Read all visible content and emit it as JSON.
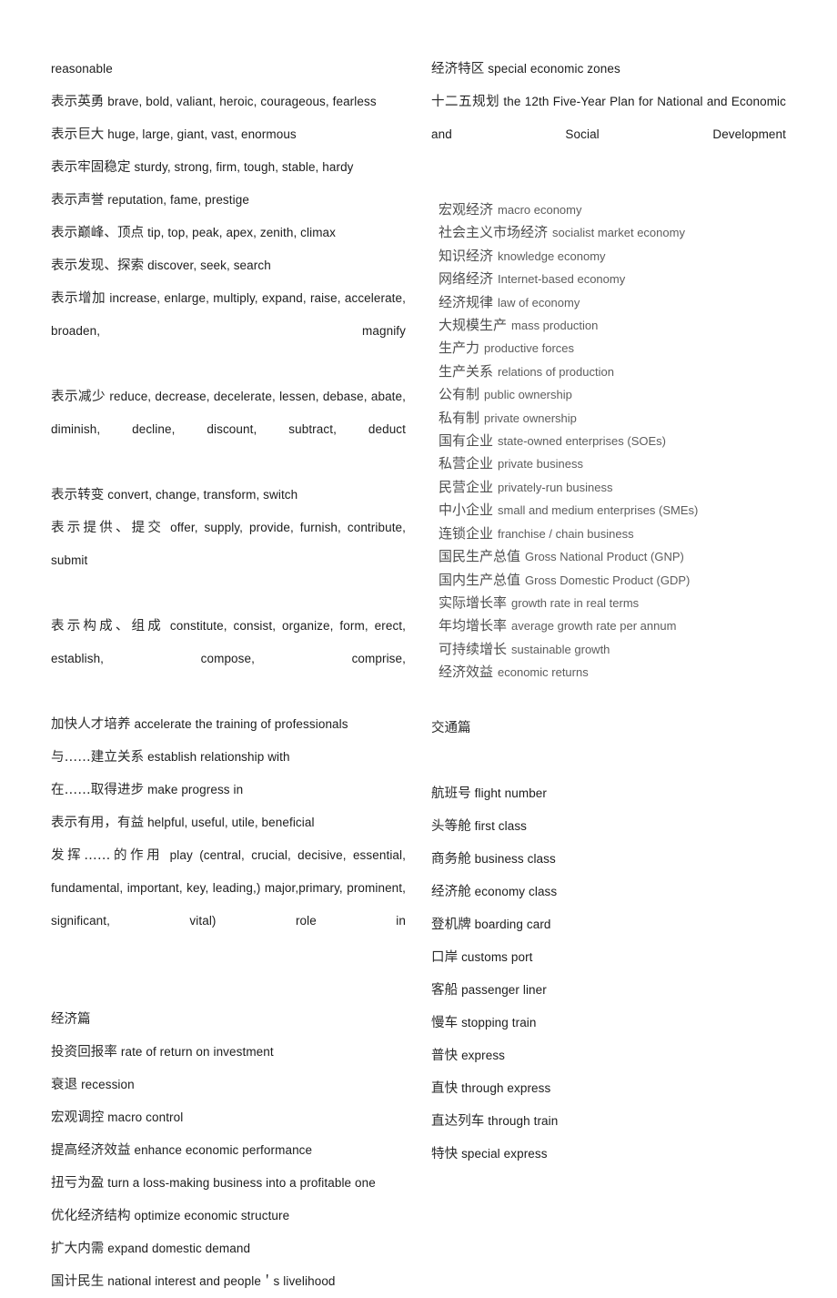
{
  "document": {
    "columns": {
      "left": {
        "blocks": [
          {
            "type": "entry",
            "cn": "",
            "en": "reasonable"
          },
          {
            "type": "entry",
            "cn": "表示英勇",
            "en": "brave, bold, valiant, heroic, courageous, fearless"
          },
          {
            "type": "entry",
            "cn": "表示巨大",
            "en": "huge, large, giant, vast, enormous"
          },
          {
            "type": "entry",
            "cn": "表示牢固稳定",
            "en": "sturdy, strong, firm, tough, stable, hardy"
          },
          {
            "type": "entry",
            "cn": "表示声誉",
            "en": "reputation, fame, prestige"
          },
          {
            "type": "entry",
            "cn": "表示巅峰、顶点",
            "en": "tip, top, peak, apex, zenith, climax"
          },
          {
            "type": "entry",
            "cn": "表示发现、探索",
            "en": "discover, seek, search"
          },
          {
            "type": "entry-wrap",
            "cn": "表示增加",
            "en": "increase, enlarge, multiply, expand, raise, accelerate, broaden, magnify"
          },
          {
            "type": "entry-wrap",
            "cn": "表示减少",
            "en": "reduce, decrease, decelerate, lessen, debase, abate, diminish, decline, discount, subtract, deduct"
          },
          {
            "type": "entry",
            "cn": "表示转变",
            "en": "convert, change, transform, switch"
          },
          {
            "type": "entry-wrap",
            "cn": "表示提供、提交",
            "en": "offer, supply, provide, furnish, contribute, submit"
          },
          {
            "type": "entry-wrap",
            "cn": "表示构成、组成",
            "en": "constitute, consist, organize, form, erect, establish, compose, comprise,"
          },
          {
            "type": "entry",
            "cn": "加快人才培养",
            "en": "accelerate the training of professionals"
          },
          {
            "type": "entry",
            "cn": "与……建立关系",
            "en": "establish relationship with"
          },
          {
            "type": "entry",
            "cn": "在……取得进步",
            "en": "make progress in"
          },
          {
            "type": "entry",
            "cn": "表示有用，有益",
            "en": "helpful, useful, utile, beneficial"
          },
          {
            "type": "entry-wrap",
            "cn": "发挥……的作用",
            "en": "play (central, crucial, decisive, essential, fundamental, important, key, leading,) major,primary, prominent, significant, vital) role in"
          },
          {
            "type": "gap-lg"
          },
          {
            "type": "heading",
            "cn": "经济篇"
          },
          {
            "type": "entry",
            "cn": "投资回报率",
            "en": "rate of return on investment"
          },
          {
            "type": "entry",
            "cn": "衰退",
            "en": "recession"
          },
          {
            "type": "entry",
            "cn": "宏观调控",
            "en": "macro control"
          },
          {
            "type": "entry",
            "cn": "提高经济效益",
            "en": "enhance economic performance"
          },
          {
            "type": "entry",
            "cn": "扭亏为盈",
            "en": "turn a loss-making business into a profitable one"
          },
          {
            "type": "entry",
            "cn": "优化经济结构",
            "en": "optimize economic structure"
          },
          {
            "type": "entry",
            "cn": "扩大内需",
            "en": "expand domestic demand"
          },
          {
            "type": "entry",
            "cn": "国计民生",
            "en": "national interest and people＇s livelihood"
          }
        ]
      },
      "right": {
        "blocks": [
          {
            "type": "entry",
            "cn": "经济特区",
            "en": "special economic zones"
          },
          {
            "type": "entry-wrap",
            "cn": "十二五规划",
            "en": "the 12th Five-Year Plan for National and Economic and Social Development"
          },
          {
            "type": "gap-sm"
          },
          {
            "type": "compact",
            "rows": [
              {
                "cn": "宏观经济",
                "en": "macro economy"
              },
              {
                "cn": "社会主义市场经济",
                "en": "socialist market economy"
              },
              {
                "cn": "知识经济",
                "en": "knowledge economy"
              },
              {
                "cn": "网络经济",
                "en": "Internet-based economy"
              },
              {
                "cn": "经济规律",
                "en": "law of economy"
              },
              {
                "cn": "大规模生产",
                "en": "mass production"
              },
              {
                "cn": "生产力",
                "en": "productive forces"
              },
              {
                "cn": "生产关系",
                "en": "relations of production"
              },
              {
                "cn": "公有制",
                "en": "public ownership"
              },
              {
                "cn": "私有制",
                "en": "private ownership"
              },
              {
                "cn": "国有企业",
                "en": "state-owned enterprises (SOEs)"
              },
              {
                "cn": "私营企业",
                "en": "private business"
              },
              {
                "cn": "民营企业",
                "en": "privately-run business"
              },
              {
                "cn": "中小企业",
                "en": "small and medium enterprises (SMEs)"
              },
              {
                "cn": "连锁企业",
                "en": "franchise / chain business"
              },
              {
                "cn": "国民生产总值",
                "en": "Gross National Product (GNP)"
              },
              {
                "cn": "国内生产总值",
                "en": "Gross Domestic Product (GDP)"
              },
              {
                "cn": "实际增长率",
                "en": "growth rate in real terms"
              },
              {
                "cn": "年均增长率",
                "en": "average growth rate per annum"
              },
              {
                "cn": "可持续增长",
                "en": "sustainable growth"
              },
              {
                "cn": "经济效益",
                "en": "economic returns"
              }
            ]
          },
          {
            "type": "gap-md"
          },
          {
            "type": "heading",
            "cn": "交通篇"
          },
          {
            "type": "gap-lg"
          },
          {
            "type": "entry",
            "cn": "航班号",
            "en": "flight number"
          },
          {
            "type": "entry",
            "cn": "头等舱",
            "en": "first class"
          },
          {
            "type": "entry",
            "cn": "商务舱",
            "en": "business class"
          },
          {
            "type": "entry",
            "cn": "经济舱",
            "en": "economy class"
          },
          {
            "type": "entry",
            "cn": "登机牌",
            "en": "boarding card"
          },
          {
            "type": "entry",
            "cn": "口岸",
            "en": "customs port"
          },
          {
            "type": "entry",
            "cn": "客船",
            "en": "passenger liner"
          },
          {
            "type": "entry",
            "cn": "慢车",
            "en": "stopping train"
          },
          {
            "type": "entry",
            "cn": "普快",
            "en": "express"
          },
          {
            "type": "entry",
            "cn": "直快",
            "en": "through express"
          },
          {
            "type": "entry",
            "cn": "直达列车",
            "en": "through train"
          },
          {
            "type": "entry",
            "cn": "特快",
            "en": "special express"
          }
        ]
      }
    }
  }
}
